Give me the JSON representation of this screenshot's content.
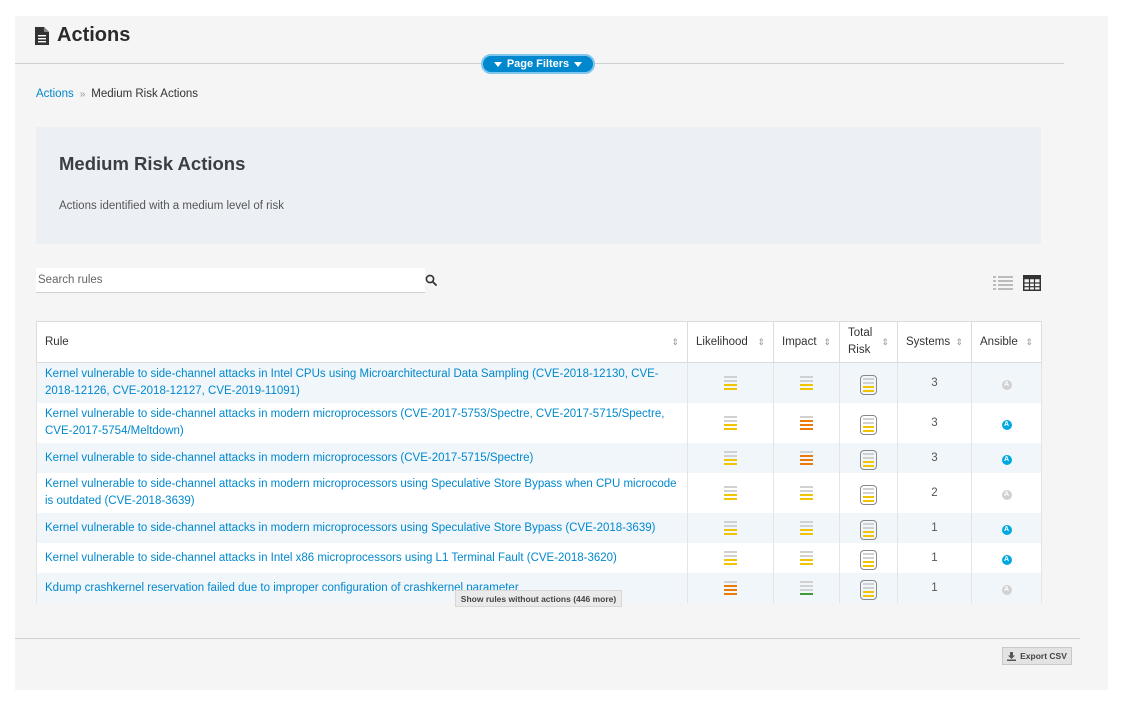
{
  "header": {
    "title": "Actions",
    "page_filters_label": "Page Filters"
  },
  "breadcrumb": {
    "root": "Actions",
    "separator": "»",
    "current": "Medium Risk Actions"
  },
  "card": {
    "title": "Medium Risk Actions",
    "description": "Actions identified with a medium level of risk"
  },
  "search": {
    "placeholder": "Search rules"
  },
  "table": {
    "columns": {
      "rule": "Rule",
      "likelihood": "Likelihood",
      "impact": "Impact",
      "total_risk_line1": "Total",
      "total_risk_line2": "Risk",
      "systems": "Systems",
      "ansible": "Ansible"
    },
    "rows": [
      {
        "rule": "Kernel vulnerable to side-channel attacks in Intel CPUs using Microarchitectural Data Sampling (CVE-2018-12130, CVE-2018-12126, CVE-2018-12127, CVE-2019-11091)",
        "likelihood": 2,
        "impact": 2,
        "total_risk": 2,
        "systems": "3",
        "ansible": false
      },
      {
        "rule": "Kernel vulnerable to side-channel attacks in modern microprocessors (CVE-2017-5753/Spectre, CVE-2017-5715/Spectre, CVE-2017-5754/Meltdown)",
        "likelihood": 2,
        "impact": 3,
        "total_risk": 2,
        "systems": "3",
        "ansible": true
      },
      {
        "rule": "Kernel vulnerable to side-channel attacks in modern microprocessors (CVE-2017-5715/Spectre)",
        "likelihood": 2,
        "impact": 3,
        "total_risk": 2,
        "systems": "3",
        "ansible": true
      },
      {
        "rule": "Kernel vulnerable to side-channel attacks in modern microprocessors using Speculative Store Bypass when CPU microcode is outdated (CVE-2018-3639)",
        "likelihood": 2,
        "impact": 2,
        "total_risk": 2,
        "systems": "2",
        "ansible": false
      },
      {
        "rule": "Kernel vulnerable to side-channel attacks in modern microprocessors using Speculative Store Bypass (CVE-2018-3639)",
        "likelihood": 2,
        "impact": 2,
        "total_risk": 2,
        "systems": "1",
        "ansible": true
      },
      {
        "rule": "Kernel vulnerable to side-channel attacks in Intel x86 microprocessors using L1 Terminal Fault (CVE-2018-3620)",
        "likelihood": 2,
        "impact": 2,
        "total_risk": 2,
        "systems": "1",
        "ansible": true
      },
      {
        "rule": "Kdump crashkernel reservation failed due to improper configuration of crashkernel parameter",
        "likelihood": 3,
        "impact": 1,
        "total_risk": 2,
        "systems": "1",
        "ansible": false
      }
    ]
  },
  "show_more_label": "Show rules without actions (446 more)",
  "export_label": "Export CSV",
  "ansible_glyph": "A",
  "colors": {
    "link": "#0088ce",
    "risk_low": "#3f9c35",
    "risk_medium": "#f0c400",
    "risk_high": "#ec7a08",
    "risk_off": "#d1d1d1",
    "ansible_on": "#00a8e1",
    "ansible_off": "#d1d1d1"
  },
  "icons": {
    "header": "document-icon",
    "search": "search-icon",
    "list_view": "list-view-icon",
    "table_view": "table-view-icon",
    "export": "download-icon"
  }
}
